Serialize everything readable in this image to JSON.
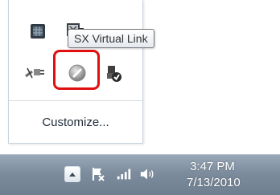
{
  "overflow_panel": {
    "icons": [
      {
        "name": "grid-box-icon"
      },
      {
        "name": "monitor-icon"
      },
      {
        "name": "unplugged-cable-icon"
      },
      {
        "name": "sx-virtual-link-icon"
      },
      {
        "name": "device-status-icon"
      }
    ],
    "tooltip": "SX Virtual Link",
    "customize_label": "Customize...",
    "highlight_color": "#e01010"
  },
  "taskbar": {
    "time": "3:47 PM",
    "date": "7/13/2010"
  }
}
